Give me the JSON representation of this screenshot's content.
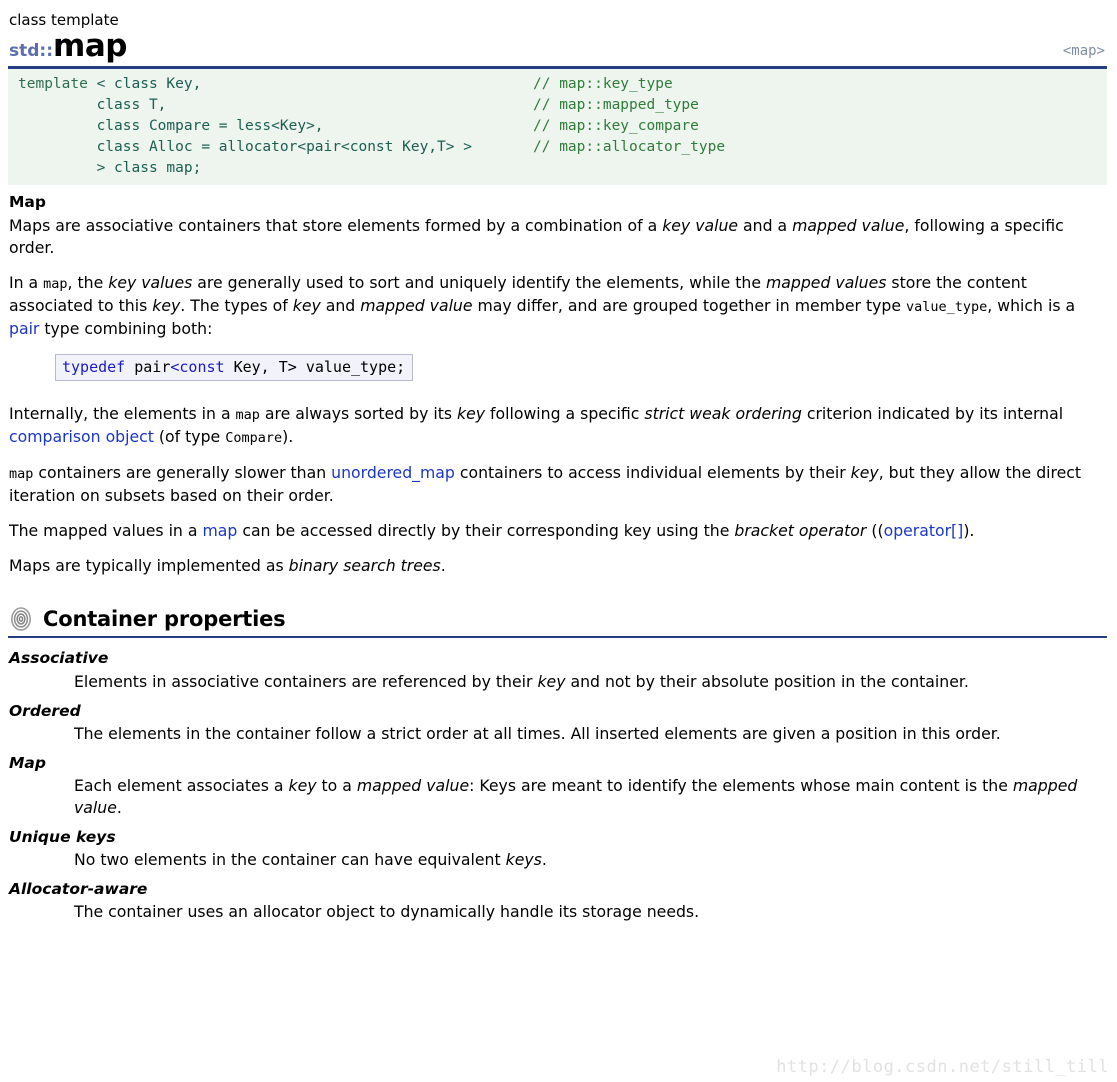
{
  "header": {
    "kicker": "class template",
    "namespace": "std::",
    "name": "map",
    "include": "<map>"
  },
  "synopsis": {
    "lines": [
      {
        "code_kw": "template",
        "code_rest": " < class Key,",
        "comment": "// map::key_type"
      },
      {
        "code_kw": "",
        "code_rest": "         class T,",
        "comment": "// map::mapped_type"
      },
      {
        "code_kw": "",
        "code_rest": "         class Compare = less<Key>,",
        "comment": "// map::key_compare"
      },
      {
        "code_kw": "",
        "code_rest": "         class Alloc = allocator<pair<const Key,T> >",
        "comment": "// map::allocator_type"
      },
      {
        "code_kw": "",
        "code_rest": "         > class map;",
        "comment": ""
      }
    ],
    "full_text": "template < class Key,\n         class T,\n         class Compare = less<Key>,\n         class Alloc = allocator<pair<const Key,T> >\n         > class map;"
  },
  "map_section": {
    "heading": "Map",
    "p1_a": "Maps are associative containers that store elements formed by a combination of a ",
    "p1_i1": "key value",
    "p1_b": " and a ",
    "p1_i2": "mapped value",
    "p1_c": ", following a specific order.",
    "p2_a": "In a ",
    "p2_code1": "map",
    "p2_b": ", the ",
    "p2_i1": "key values",
    "p2_c": " are generally used to sort and uniquely identify the elements, while the ",
    "p2_i2": "mapped values",
    "p2_d": " store the content associated to this ",
    "p2_i3": "key",
    "p2_e": ". The types of ",
    "p2_i4": "key",
    "p2_f": " and ",
    "p2_i5": "mapped value",
    "p2_g": " may differ, and are grouped together in member type ",
    "p2_code2": "value_type",
    "p2_h": ", which is a ",
    "p2_link": "pair",
    "p2_i": " type combining both:",
    "typedef_kw1": "typedef",
    "typedef_mid1": " pair",
    "typedef_kw2": "<const",
    "typedef_mid2": " Key, T> value_type;",
    "typedef_full": "typedef pair<const Key, T> value_type;",
    "p3_a": "Internally, the elements in a ",
    "p3_code1": "map",
    "p3_b": " are always sorted by its ",
    "p3_i1": "key",
    "p3_c": " following a specific ",
    "p3_i2": "strict weak ordering",
    "p3_d": " criterion indicated by its internal ",
    "p3_link": "comparison object",
    "p3_e": " (of type ",
    "p3_code2": "Compare",
    "p3_f": ").",
    "p4_code1": "map",
    "p4_a": " containers are generally slower than ",
    "p4_link": "unordered_map",
    "p4_b": " containers to access individual elements by their ",
    "p4_i1": "key",
    "p4_c": ", but they allow the direct iteration on subsets based on their order.",
    "p5_a": "The mapped values in a ",
    "p5_link1": "map",
    "p5_b": " can be accessed directly by their corresponding key using the ",
    "p5_i1": "bracket operator",
    "p5_c": " ((",
    "p5_link2": "operator[]",
    "p5_d": ").",
    "p6_a": "Maps are typically implemented as ",
    "p6_i1": "binary search trees",
    "p6_b": "."
  },
  "container_properties": {
    "icon": "spiral-icon",
    "heading": "Container properties",
    "items": [
      {
        "term": "Associative",
        "desc_a": "Elements in associative containers are referenced by their ",
        "desc_i": "key",
        "desc_b": " and not by their absolute position in the container."
      },
      {
        "term": "Ordered",
        "desc_a": "The elements in the container follow a strict order at all times. All inserted elements are given a position in this order.",
        "desc_i": "",
        "desc_b": ""
      },
      {
        "term": "Map",
        "desc_a": "Each element associates a ",
        "desc_i": "key",
        "desc_b": " to a ",
        "desc_i2": "mapped value",
        "desc_c": ": Keys are meant to identify the elements whose main content is the ",
        "desc_i3": "mapped value",
        "desc_d": "."
      },
      {
        "term": "Unique keys",
        "desc_a": "No two elements in the container can have equivalent ",
        "desc_i": "keys",
        "desc_b": "."
      },
      {
        "term": "Allocator-aware",
        "desc_a": "The container uses an allocator object to dynamically handle its storage needs.",
        "desc_i": "",
        "desc_b": ""
      }
    ]
  },
  "watermark": {
    "text": "http://blog.csdn.net/still_till"
  },
  "colors": {
    "rule": "#263d82",
    "namespace": "#5b6fb0",
    "link": "#1a36c8",
    "synopsis_bg": "#eef4ee",
    "comment": "#2f7d3a",
    "typedef_bg": "#f2f2fa",
    "watermark": "#e2e2e2"
  }
}
